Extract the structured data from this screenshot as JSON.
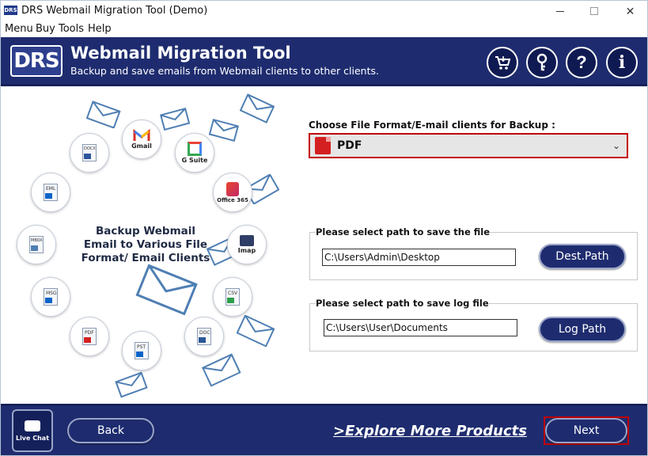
{
  "window": {
    "badge": "DRS",
    "title": "DRS Webmail Migration Tool (Demo)",
    "min": "",
    "max": "",
    "close": "✕"
  },
  "menu": [
    "Menu",
    "Buy",
    "Tools",
    "Help"
  ],
  "header": {
    "logo": "DRS",
    "title": "Webmail Migration Tool",
    "subtitle": "Backup and save emails from Webmail clients to other clients.",
    "icons": [
      "cart-icon",
      "key-icon",
      "help-icon",
      "info-icon"
    ],
    "icon_glyphs": [
      "🛒",
      "⚷",
      "?",
      "i"
    ]
  },
  "illustration": {
    "center_text": "Backup Webmail Email to Various File Format/ Email Clients",
    "items": {
      "gmail": "Gmail",
      "gsuite": "G Suite",
      "office365": "Office 365",
      "imap": "Imap",
      "csv": "CSV",
      "doc": "DOC",
      "pst": "PST",
      "pdf": "PDF",
      "msg": "MSG",
      "mbox": "MBOX",
      "eml": "EML",
      "docx": "DOCX"
    }
  },
  "format": {
    "label": "Choose File Format/E-mail clients for Backup :",
    "selected": "PDF"
  },
  "save_path": {
    "label": "Please select path to save the file",
    "value": "C:\\Users\\Admin\\Desktop",
    "button": "Dest.Path"
  },
  "log_path": {
    "label": "Please select path to save log file",
    "value": "C:\\Users\\User\\Documents",
    "button": "Log Path"
  },
  "footer": {
    "live_chat": "Live Chat",
    "back": "Back",
    "explore": ">Explore More Products",
    "next": "Next"
  },
  "colors": {
    "header_bg": "#1e2c6f",
    "highlight": "#c40000"
  }
}
